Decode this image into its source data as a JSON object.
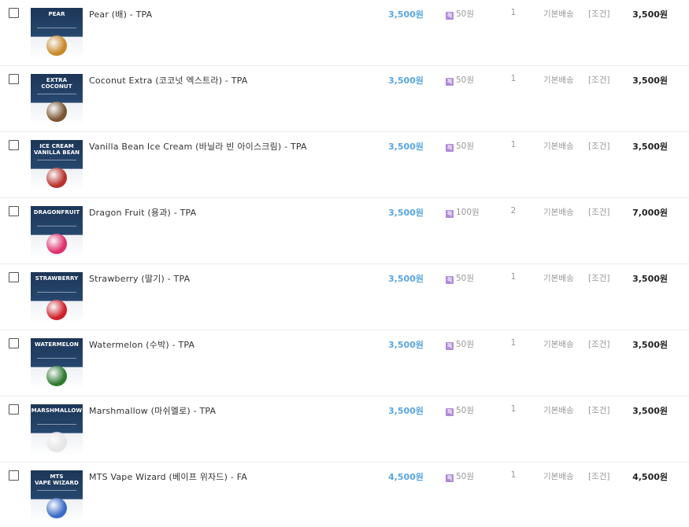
{
  "cart": {
    "items": [
      {
        "name": "Pear (배) - TPA",
        "thumb_label": "PEAR",
        "icon": "pear-image",
        "art_color": "#c98a2a",
        "price": "3,500원",
        "points_badge": "적",
        "points": "50원",
        "qty": "1",
        "shipping": "기본배송",
        "condition": "[조건]",
        "total": "3,500원"
      },
      {
        "name": "Coconut Extra (코코넛 엑스트라) - TPA",
        "thumb_label": "EXTRA\nCOCONUT",
        "icon": "coconut-image",
        "art_color": "#7a5632",
        "price": "3,500원",
        "points_badge": "적",
        "points": "50원",
        "qty": "1",
        "shipping": "기본배송",
        "condition": "[조건]",
        "total": "3,500원"
      },
      {
        "name": "Vanilla Bean Ice Cream (바닐라 빈 아이스크림) - TPA",
        "thumb_label": "ICE CREAM\nVANILLA BEAN",
        "icon": "ice-cream-image",
        "art_color": "#b9322c",
        "price": "3,500원",
        "points_badge": "적",
        "points": "50원",
        "qty": "1",
        "shipping": "기본배송",
        "condition": "[조건]",
        "total": "3,500원"
      },
      {
        "name": "Dragon Fruit (용과) - TPA",
        "thumb_label": "DRAGONFRUIT",
        "icon": "dragonfruit-image",
        "art_color": "#e0306e",
        "price": "3,500원",
        "points_badge": "적",
        "points": "100원",
        "qty": "2",
        "shipping": "기본배송",
        "condition": "[조건]",
        "total": "7,000원"
      },
      {
        "name": "Strawberry (딸기) - TPA",
        "thumb_label": "STRAWBERRY",
        "icon": "strawberry-image",
        "art_color": "#d0222a",
        "price": "3,500원",
        "points_badge": "적",
        "points": "50원",
        "qty": "1",
        "shipping": "기본배송",
        "condition": "[조건]",
        "total": "3,500원"
      },
      {
        "name": "Watermelon (수박) - TPA",
        "thumb_label": "WATERMELON",
        "icon": "watermelon-image",
        "art_color": "#2f7a33",
        "price": "3,500원",
        "points_badge": "적",
        "points": "50원",
        "qty": "1",
        "shipping": "기본배송",
        "condition": "[조건]",
        "total": "3,500원"
      },
      {
        "name": "Marshmallow (마쉬멜로) - TPA",
        "thumb_label": "MARSHMALLOW",
        "icon": "marshmallow-image",
        "art_color": "#e6e6e6",
        "price": "3,500원",
        "points_badge": "적",
        "points": "50원",
        "qty": "1",
        "shipping": "기본배송",
        "condition": "[조건]",
        "total": "3,500원"
      },
      {
        "name": "MTS Vape Wizard (베이프 위자드) - FA",
        "thumb_label": "MTS\nVAPE WIZARD",
        "icon": "vape-wizard-image",
        "art_color": "#3a6bc9",
        "price": "4,500원",
        "points_badge": "적",
        "points": "50원",
        "qty": "1",
        "shipping": "기본배송",
        "condition": "[조건]",
        "total": "4,500원"
      }
    ]
  },
  "colors": {
    "price": "#5aa6df",
    "points_icon": "#b08ad6",
    "muted": "#999999"
  }
}
